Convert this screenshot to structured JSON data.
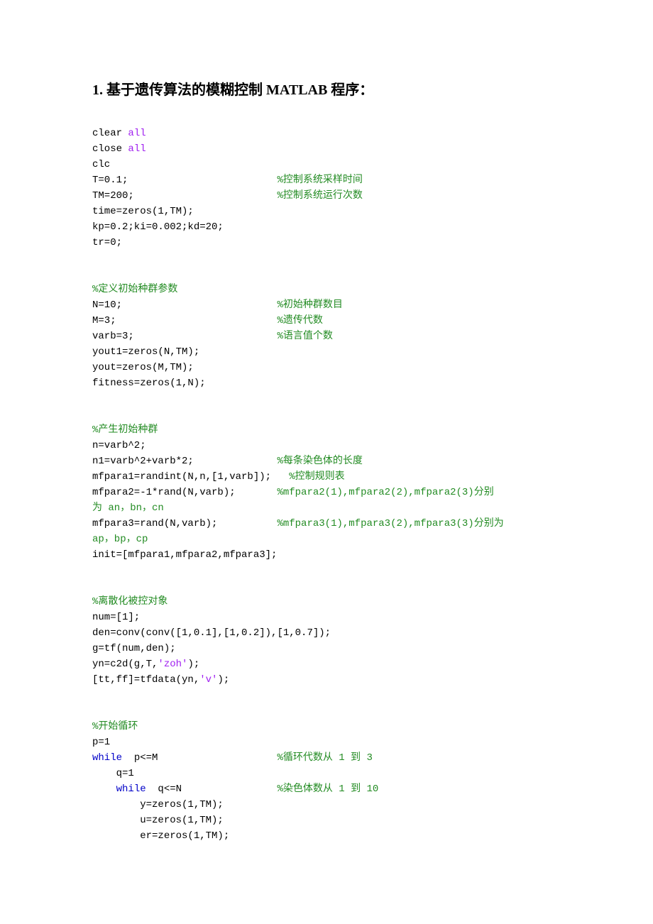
{
  "heading": "1.  基于遗传算法的模糊控制 MATLAB 程序：",
  "l01a": "clear ",
  "l01b": "all",
  "l02a": "close ",
  "l02b": "all",
  "l03": "clc",
  "l04a": "T=0.1;                         ",
  "l04c": "%控制系统采样时间",
  "l05a": "TM=200;                        ",
  "l05c": "%控制系统运行次数",
  "l06": "time=zeros(1,TM);",
  "l07": "kp=0.2;ki=0.002;kd=20;",
  "l08": "tr=0;",
  "l09c": "%定义初始种群参数",
  "l10a": "N=10;                          ",
  "l10c": "%初始种群数目",
  "l11a": "M=3;                           ",
  "l11c": "%遗传代数",
  "l12a": "varb=3;                        ",
  "l12c": "%语言值个数",
  "l13": "yout1=zeros(N,TM);",
  "l14": "yout=zeros(M,TM);",
  "l15": "fitness=zeros(1,N);",
  "l16c": "%产生初始种群",
  "l17": "n=varb^2;",
  "l18a": "n1=varb^2+varb*2;              ",
  "l18c": "%每条染色体的长度",
  "l19a": "mfpara1=randint(N,n,[1,varb]);   ",
  "l19c": "%控制规则表",
  "l20a": "mfpara2=-1*rand(N,varb);       ",
  "l20c": "%mfpara2(1),mfpara2(2),mfpara2(3)分别",
  "l20d": "为 an，bn，cn",
  "l21a": "mfpara3=rand(N,varb);          ",
  "l21c": "%mfpara3(1),mfpara3(2),mfpara3(3)分别为",
  "l21d": "ap，bp，cp",
  "l22": "init=[mfpara1,mfpara2,mfpara3];",
  "l23c": "%离散化被控对象",
  "l24": "num=[1];",
  "l25": "den=conv(conv([1,0.1],[1,0.2]),[1,0.7]);",
  "l26": "g=tf(num,den);",
  "l27a": "yn=c2d(g,T,",
  "l27s": "'zoh'",
  "l27b": ");",
  "l28a": "[tt,ff]=tfdata(yn,",
  "l28s": "'v'",
  "l28b": ");",
  "l29c": "%开始循环",
  "l30": "p=1",
  "l31k": "while",
  "l31a": "  p<=M                    ",
  "l31c": "%循环代数从 1 到 3",
  "l32": "    q=1",
  "l33pad": "    ",
  "l33k": "while",
  "l33a": "  q<=N                ",
  "l33c": "%染色体数从 1 到 10",
  "l34": "        y=zeros(1,TM);",
  "l35": "        u=zeros(1,TM);",
  "l36": "        er=zeros(1,TM);"
}
